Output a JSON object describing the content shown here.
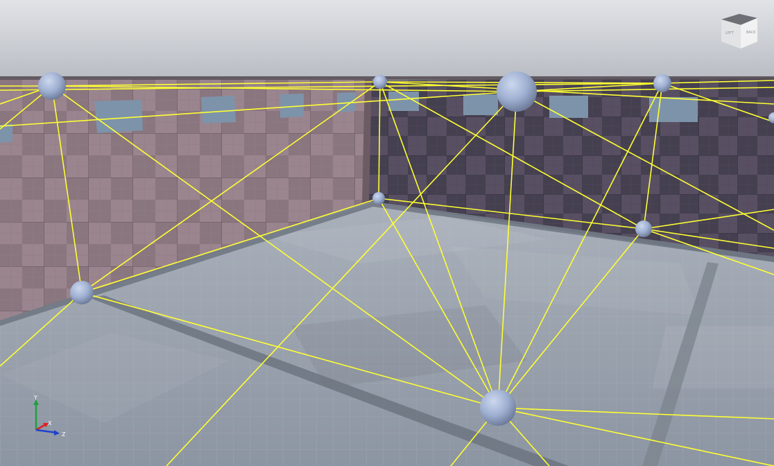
{
  "viewport": {
    "colors": {
      "sky_top": "#d3d6dc",
      "sky_bottom": "#b5b9c0",
      "left_wall": "#85727b",
      "back_wall": "#514a5b",
      "floor": "#97a0ac",
      "window": "#7f96ad",
      "link_line": "#ffff33",
      "node": "#9fb0d2"
    }
  },
  "view_cube": {
    "left_face_label": "LEFT",
    "back_face_label": "BACK"
  },
  "axis_gizmo": {
    "x_label": "X",
    "y_label": "Y",
    "z_label": "Z",
    "x_color": "#e02020",
    "y_color": "#20a040",
    "z_color": "#2040d0"
  }
}
